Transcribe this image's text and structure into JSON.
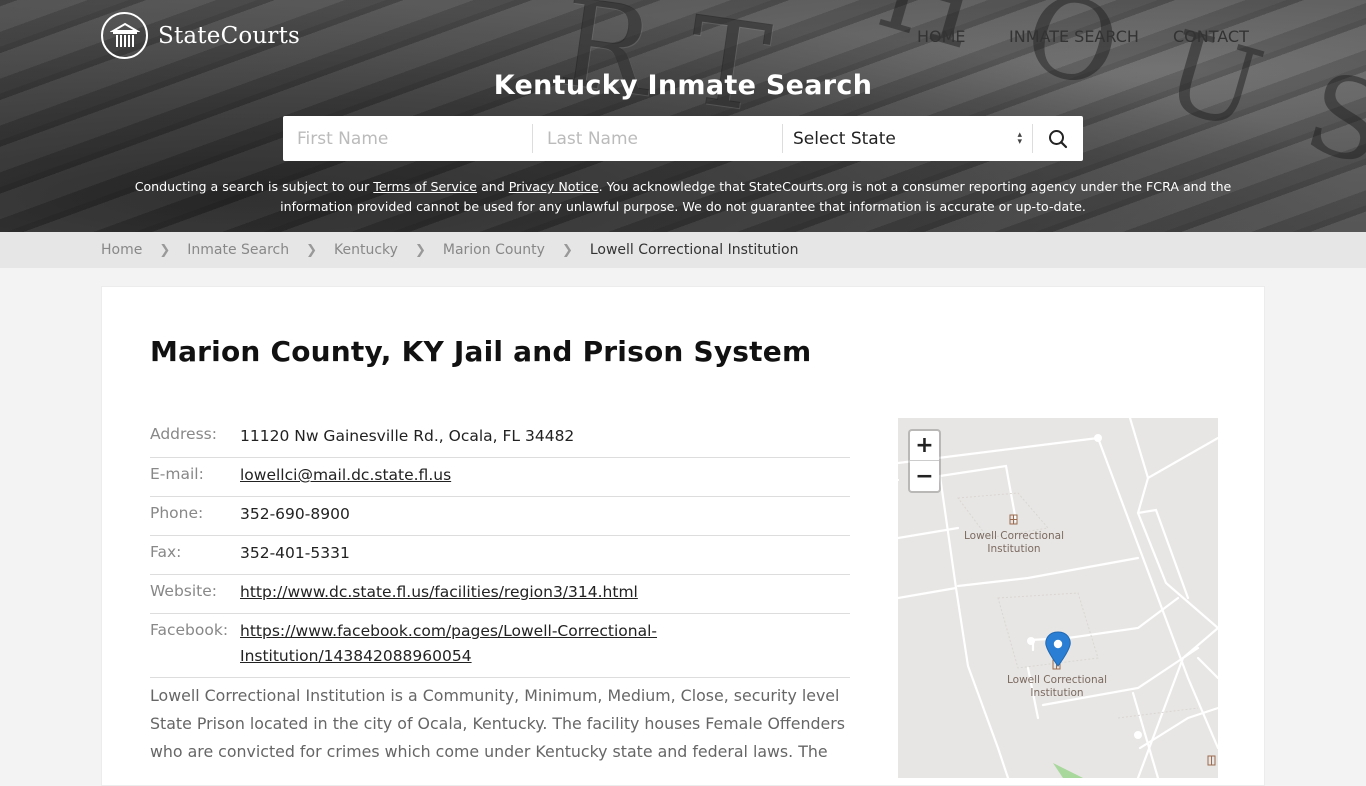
{
  "site": {
    "brand": "StateCourts",
    "nav": [
      {
        "label": "HOME"
      },
      {
        "label": "INMATE SEARCH"
      },
      {
        "label": "CONTACT"
      }
    ]
  },
  "hero": {
    "title": "Kentucky Inmate Search",
    "search": {
      "first_name_placeholder": "First Name",
      "last_name_placeholder": "Last Name",
      "state_select_value": "Select State"
    },
    "disclaimer": {
      "part1": "Conducting a search is subject to our ",
      "terms_link": "Terms of Service",
      "part2": " and ",
      "privacy_link": "Privacy Notice",
      "part3": ". You acknowledge that StateCourts.org is not a consumer reporting agency under the FCRA and the information provided cannot be used for any unlawful purpose. We do not guarantee that information is accurate or up-to-date."
    }
  },
  "breadcrumb": [
    {
      "label": "Home"
    },
    {
      "label": "Inmate Search"
    },
    {
      "label": "Kentucky"
    },
    {
      "label": "Marion County"
    },
    {
      "label": "Lowell Correctional Institution"
    }
  ],
  "main": {
    "title": "Marion County, KY Jail and Prison System",
    "info": {
      "address_label": "Address:",
      "address": "11120 Nw Gainesville Rd., Ocala, FL 34482",
      "email_label": "E-mail:",
      "email": "lowellci@mail.dc.state.fl.us",
      "phone_label": "Phone:",
      "phone": "352-690-8900",
      "fax_label": "Fax:",
      "fax": "352-401-5331",
      "website_label": "Website:",
      "website": "http://www.dc.state.fl.us/facilities/region3/314.html",
      "facebook_label": "Facebook:",
      "facebook_line1": "https://www.facebook.com/pages/Lowell-Correctional-",
      "facebook_line2": "Institution/143842088960054"
    },
    "description": "Lowell Correctional Institution is a Community, Minimum, Medium, Close, security level State Prison located in the city of Ocala, Kentucky. The facility houses Female Offenders who are convicted for crimes which come under Kentucky state and federal laws. The"
  },
  "map": {
    "zoom_in": "+",
    "zoom_out": "−",
    "labels": [
      {
        "line1": "Lowell Correctional",
        "line2": "Institution"
      },
      {
        "line1": "Lowell Correctional",
        "line2": "Institution"
      }
    ],
    "marker_color": "#2a7fd4"
  }
}
